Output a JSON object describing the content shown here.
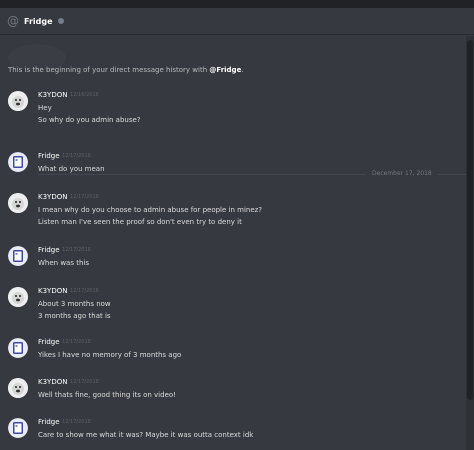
{
  "header": {
    "title": "Fridge",
    "icon": "at-sign-icon",
    "status": "offline"
  },
  "history_intro": {
    "prefix": "This is the beginning of your direct message history with ",
    "name": "@Fridge",
    "suffix": "."
  },
  "date_divider": "December 17, 2018",
  "messages": [
    {
      "user": "K3YDON",
      "time": "12/16/2018",
      "lines": [
        "Hey",
        "So why do you admin abuse?"
      ]
    },
    {
      "user": "Fridge",
      "time": "12/17/2018",
      "lines": [
        "What do you mean"
      ]
    },
    {
      "user": "K3YDON",
      "time": "12/17/2018",
      "lines": [
        "I mean why do you choose to admin abuse for people in minez?",
        "Listen man I've seen the proof so don't even try to deny it"
      ]
    },
    {
      "user": "Fridge",
      "time": "12/17/2018",
      "lines": [
        "When was this"
      ]
    },
    {
      "user": "K3YDON",
      "time": "12/17/2018",
      "lines": [
        "About 3 months now",
        "3 months ago that is"
      ]
    },
    {
      "user": "Fridge",
      "time": "12/17/2018",
      "lines": [
        "Yikes I have no memory of 3 months ago"
      ]
    },
    {
      "user": "K3YDON",
      "time": "12/17/2018",
      "lines": [
        "Well thats fine, good thing its on video!"
      ]
    },
    {
      "user": "Fridge",
      "time": "12/17/2018",
      "lines": [
        "Care to show me what it was? Maybe it was outta context idk"
      ]
    }
  ],
  "colors": {
    "background": "#36393f",
    "text": "#dcddde",
    "username": "#ffffff",
    "timestamp": "#5e6168"
  }
}
